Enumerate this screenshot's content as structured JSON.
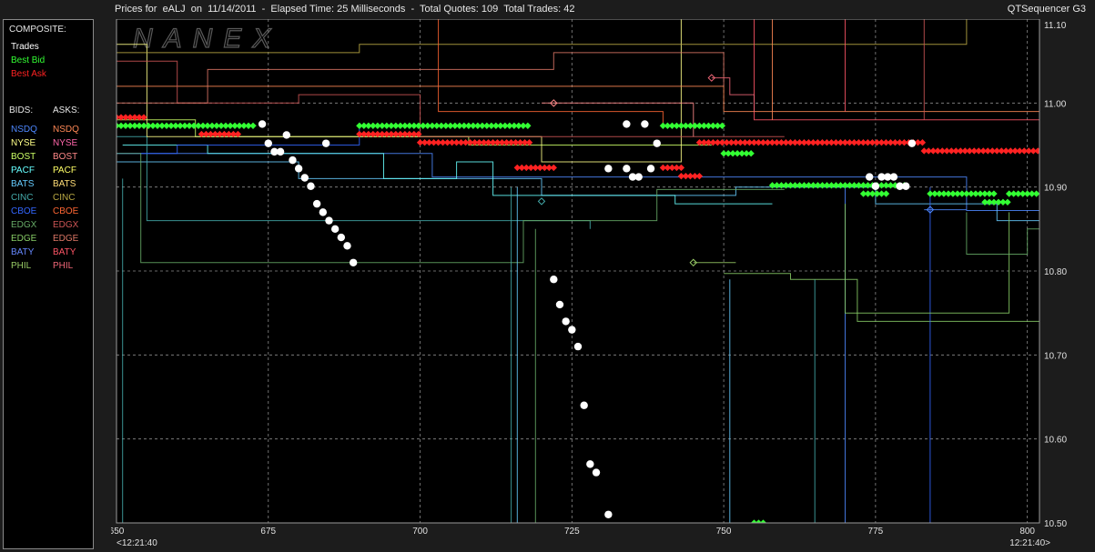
{
  "window": {
    "title": "Prices for  eALJ  on  11/14/2011  -  Elapsed Time: 25 Milliseconds  -  Total Quotes: 109  Total Trades: 42",
    "app_name": "QTSequencer G3",
    "watermark": "NANEX"
  },
  "legend": {
    "composite_header": "COMPOSITE:",
    "composite": [
      {
        "label": "Trades",
        "color": "#ffffff"
      },
      {
        "label": "Best Bid",
        "color": "#33ff33"
      },
      {
        "label": "Best Ask",
        "color": "#ff2222"
      }
    ],
    "bids_header": "BIDS:",
    "asks_header": "ASKS:",
    "exchanges": [
      {
        "bid": "NSDQ",
        "ask": "NSDQ",
        "bid_color": "#4d88ff",
        "ask_color": "#ff8855"
      },
      {
        "bid": "NYSE",
        "ask": "NYSE",
        "bid_color": "#ffff88",
        "ask_color": "#ff66aa"
      },
      {
        "bid": "BOST",
        "ask": "BOST",
        "bid_color": "#ccff66",
        "ask_color": "#ff8888"
      },
      {
        "bid": "PACF",
        "ask": "PACF",
        "bid_color": "#66ffff",
        "ask_color": "#ffff66"
      },
      {
        "bid": "BATS",
        "ask": "BATS",
        "bid_color": "#66ccff",
        "ask_color": "#ffdd77"
      },
      {
        "bid": "CINC",
        "ask": "CINC",
        "bid_color": "#44aaaa",
        "ask_color": "#bbaa44"
      },
      {
        "bid": "CBOE",
        "ask": "CBOE",
        "bid_color": "#3366ff",
        "ask_color": "#ff6633"
      },
      {
        "bid": "EDGX",
        "ask": "EDGX",
        "bid_color": "#66aa66",
        "ask_color": "#cc5555"
      },
      {
        "bid": "EDGE",
        "ask": "EDGE",
        "bid_color": "#88cc66",
        "ask_color": "#dd7766"
      },
      {
        "bid": "BATY",
        "ask": "BATY",
        "bid_color": "#6688ff",
        "ask_color": "#ff5566"
      },
      {
        "bid": "PHIL",
        "ask": "PHIL",
        "bid_color": "#99cc66",
        "ask_color": "#ee6677"
      }
    ]
  },
  "chart_data": {
    "type": "scatter",
    "title": "",
    "xlabel": "",
    "ylabel": "",
    "xlim": [
      650,
      802
    ],
    "ylim": [
      10.5,
      11.1
    ],
    "x_ticks": [
      650,
      675,
      700,
      725,
      750,
      775,
      800
    ],
    "x_tick_labels": [
      "650",
      "675",
      "700",
      "725",
      "750",
      "775",
      "800"
    ],
    "x_start_time": "<12:21:40",
    "x_end_time": "12:21:40>",
    "y_ticks": [
      10.5,
      10.6,
      10.7,
      10.8,
      10.9,
      11.0,
      11.1
    ],
    "y_tick_labels": [
      "10.50",
      "10.60",
      "10.70",
      "10.80",
      "10.90",
      "11.00",
      "11.10"
    ],
    "grid": true,
    "series": [
      {
        "name": "Trades",
        "color": "#ffffff",
        "points": [
          [
            674,
            10.975
          ],
          [
            675,
            10.952
          ],
          [
            676,
            10.942
          ],
          [
            677,
            10.942
          ],
          [
            678,
            10.962
          ],
          [
            679,
            10.932
          ],
          [
            680,
            10.922
          ],
          [
            681,
            10.911
          ],
          [
            682,
            10.901
          ],
          [
            683,
            10.88
          ],
          [
            684,
            10.87
          ],
          [
            684.5,
            10.952
          ],
          [
            685,
            10.86
          ],
          [
            686,
            10.85
          ],
          [
            687,
            10.84
          ],
          [
            688,
            10.83
          ],
          [
            689,
            10.81
          ],
          [
            722,
            10.79
          ],
          [
            723,
            10.76
          ],
          [
            724,
            10.74
          ],
          [
            725,
            10.73
          ],
          [
            726,
            10.71
          ],
          [
            727,
            10.64
          ],
          [
            728,
            10.57
          ],
          [
            729,
            10.56
          ],
          [
            731,
            10.51
          ],
          [
            731,
            10.922
          ],
          [
            734,
            10.975
          ],
          [
            734,
            10.922
          ],
          [
            735,
            10.912
          ],
          [
            736,
            10.912
          ],
          [
            737,
            10.975
          ],
          [
            738,
            10.922
          ],
          [
            739,
            10.952
          ],
          [
            774,
            10.912
          ],
          [
            775,
            10.901
          ],
          [
            776,
            10.912
          ],
          [
            777,
            10.912
          ],
          [
            778,
            10.912
          ],
          [
            779,
            10.901
          ],
          [
            780,
            10.901
          ],
          [
            781,
            10.952
          ]
        ]
      },
      {
        "name": "Best Bid",
        "color": "#33ff33",
        "segments": [
          [
            650,
            673,
            10.973
          ],
          [
            690,
            718,
            10.973
          ],
          [
            740,
            750,
            10.973
          ],
          [
            750,
            755,
            10.94
          ],
          [
            758,
            780,
            10.902
          ],
          [
            773,
            777,
            10.892
          ],
          [
            784,
            795,
            10.892
          ],
          [
            793,
            797,
            10.882
          ],
          [
            797,
            802,
            10.892
          ],
          [
            755,
            757,
            10.5
          ]
        ]
      },
      {
        "name": "Best Ask",
        "color": "#ff2222",
        "segments": [
          [
            650,
            655,
            10.983
          ],
          [
            664,
            670,
            10.963
          ],
          [
            690,
            700,
            10.963
          ],
          [
            700,
            718,
            10.953
          ],
          [
            716,
            722,
            10.923
          ],
          [
            740,
            743,
            10.923
          ],
          [
            743,
            746,
            10.913
          ],
          [
            746,
            783,
            10.953
          ],
          [
            783,
            802,
            10.943
          ]
        ]
      }
    ],
    "quote_lines": [
      {
        "color": "#4d88ff",
        "points": [
          [
            650,
            10.94
          ],
          [
            702,
            10.94
          ],
          [
            702,
            10.912
          ],
          [
            790,
            10.912
          ],
          [
            790,
            10.872
          ],
          [
            802,
            10.872
          ]
        ]
      },
      {
        "color": "#66ccff",
        "points": [
          [
            650,
            10.93
          ],
          [
            680,
            10.93
          ],
          [
            680,
            10.91
          ],
          [
            720,
            10.91
          ],
          [
            720,
            10.89
          ],
          [
            752,
            10.89
          ],
          [
            752,
            10.9
          ],
          [
            775,
            10.9
          ],
          [
            775,
            10.88
          ],
          [
            795,
            10.88
          ],
          [
            795,
            10.86
          ],
          [
            802,
            10.86
          ]
        ]
      },
      {
        "color": "#66ffff",
        "points": [
          [
            651,
            10.95
          ],
          [
            665,
            10.95
          ],
          [
            665,
            10.94
          ],
          [
            694,
            10.94
          ],
          [
            694,
            10.91
          ],
          [
            706,
            10.91
          ],
          [
            706,
            10.93
          ],
          [
            712,
            10.93
          ],
          [
            712,
            10.89
          ],
          [
            742,
            10.89
          ],
          [
            742,
            10.88
          ],
          [
            758,
            10.88
          ]
        ]
      },
      {
        "color": "#44aaaa",
        "points": [
          [
            650,
            10.96
          ],
          [
            655,
            10.96
          ],
          [
            655,
            10.86
          ],
          [
            728,
            10.86
          ],
          [
            728,
            10.85
          ]
        ]
      },
      {
        "color": "#3366ff",
        "points": [
          [
            650,
            10.94
          ],
          [
            660,
            10.94
          ],
          [
            660,
            10.95
          ],
          [
            690,
            10.95
          ],
          [
            690,
            10.97
          ]
        ]
      },
      {
        "color": "#66aa66",
        "points": [
          [
            650,
            10.94
          ],
          [
            654,
            10.94
          ],
          [
            654,
            10.81
          ],
          [
            717,
            10.81
          ],
          [
            717,
            10.86
          ],
          [
            739,
            10.86
          ],
          [
            739,
            10.897
          ],
          [
            760,
            10.897
          ]
        ]
      },
      {
        "color": "#88cc66",
        "points": [
          [
            750,
            10.797
          ],
          [
            761,
            10.797
          ],
          [
            761,
            10.79
          ],
          [
            772,
            10.79
          ],
          [
            772,
            10.74
          ],
          [
            802,
            10.74
          ]
        ]
      },
      {
        "color": "#99cc66",
        "points": [
          [
            745,
            10.81
          ],
          [
            752,
            10.81
          ]
        ]
      },
      {
        "color": "#ccff66",
        "points": [
          [
            650,
            10.98
          ],
          [
            663,
            10.98
          ],
          [
            663,
            10.96
          ],
          [
            708,
            10.96
          ],
          [
            708,
            10.95
          ],
          [
            748,
            10.95
          ]
        ]
      },
      {
        "color": "#ffff88",
        "points": [
          [
            650,
            11.07
          ],
          [
            655,
            11.07
          ],
          [
            655,
            10.96
          ],
          [
            720,
            10.96
          ],
          [
            720,
            10.93
          ],
          [
            743,
            10.93
          ],
          [
            743,
            11.1
          ]
        ]
      },
      {
        "color": "#bbaa44",
        "points": [
          [
            650,
            11.06
          ],
          [
            690,
            11.06
          ],
          [
            690,
            11.07
          ],
          [
            790,
            11.07
          ],
          [
            790,
            11.1
          ]
        ]
      },
      {
        "color": "#ff8855",
        "points": [
          [
            650,
            11.02
          ],
          [
            750,
            11.02
          ],
          [
            750,
            10.99
          ],
          [
            802,
            10.99
          ]
        ]
      },
      {
        "color": "#cc5555",
        "points": [
          [
            650,
            11.05
          ],
          [
            660,
            11.05
          ],
          [
            660,
            11.0
          ],
          [
            680,
            11.0
          ],
          [
            680,
            11.01
          ],
          [
            700,
            11.01
          ],
          [
            700,
            10.96
          ],
          [
            760,
            10.96
          ]
        ]
      },
      {
        "color": "#dd7766",
        "points": [
          [
            650,
            11.0
          ],
          [
            665,
            11.0
          ],
          [
            665,
            11.04
          ],
          [
            722,
            11.04
          ],
          [
            722,
            11.06
          ],
          [
            750,
            11.06
          ],
          [
            750,
            11.02
          ]
        ]
      },
      {
        "color": "#ff5566",
        "points": [
          [
            755,
            11.1
          ],
          [
            755,
            10.98
          ],
          [
            802,
            10.98
          ]
        ]
      },
      {
        "color": "#ff6633",
        "points": [
          [
            703,
            11.1
          ],
          [
            703,
            10.99
          ],
          [
            740,
            10.99
          ],
          [
            740,
            10.97
          ]
        ]
      },
      {
        "color": "#ee6677",
        "points": [
          [
            748,
            11.03
          ],
          [
            751,
            11.03
          ],
          [
            751,
            11.01
          ],
          [
            755,
            11.01
          ],
          [
            755,
            10.99
          ]
        ]
      },
      {
        "color": "#ff8888",
        "points": [
          [
            720,
            11.0
          ],
          [
            745,
            11.0
          ],
          [
            745,
            10.96
          ]
        ]
      },
      {
        "color": "#4d88ff",
        "points": [
          [
            783,
            10.873
          ],
          [
            790,
            10.873
          ]
        ]
      },
      {
        "color": "#66ccff",
        "points": [
          [
            716,
            10.9
          ],
          [
            716,
            10.5
          ]
        ]
      },
      {
        "color": "#44aaaa",
        "points": [
          [
            715,
            10.9
          ],
          [
            715,
            10.5
          ]
        ]
      },
      {
        "color": "#66aa66",
        "points": [
          [
            719,
            10.85
          ],
          [
            719,
            10.5
          ]
        ]
      },
      {
        "color": "#44aaaa",
        "points": [
          [
            651,
            10.91
          ],
          [
            651,
            10.5
          ]
        ]
      },
      {
        "color": "#66ccff",
        "points": [
          [
            751,
            10.79
          ],
          [
            751,
            10.5
          ]
        ]
      },
      {
        "color": "#44aaaa",
        "points": [
          [
            765,
            10.79
          ],
          [
            765,
            10.5
          ]
        ]
      },
      {
        "color": "#4d88ff",
        "points": [
          [
            770,
            10.9
          ],
          [
            770,
            10.5
          ]
        ]
      },
      {
        "color": "#3366ff",
        "points": [
          [
            784,
            10.9
          ],
          [
            784,
            10.5
          ]
        ]
      },
      {
        "color": "#88cc66",
        "points": [
          [
            770,
            10.88
          ],
          [
            770,
            10.75
          ],
          [
            797,
            10.75
          ],
          [
            797,
            10.87
          ]
        ]
      },
      {
        "color": "#66aa66",
        "points": [
          [
            790,
            10.87
          ],
          [
            790,
            10.82
          ],
          [
            800,
            10.82
          ],
          [
            800,
            10.85
          ],
          [
            802,
            10.85
          ]
        ]
      },
      {
        "color": "#ff5566",
        "points": [
          [
            770,
            11.1
          ],
          [
            770,
            10.99
          ]
        ]
      },
      {
        "color": "#cc5555",
        "points": [
          [
            783,
            11.1
          ],
          [
            783,
            10.98
          ]
        ]
      },
      {
        "color": "#ff8855",
        "points": [
          [
            758,
            11.1
          ],
          [
            758,
            10.98
          ]
        ]
      }
    ],
    "quote_markers": [
      {
        "x": 722,
        "y": 11.0,
        "color": "#ff8888"
      },
      {
        "x": 748,
        "y": 11.03,
        "color": "#ee6677"
      },
      {
        "x": 720,
        "y": 10.883,
        "color": "#44aaaa"
      },
      {
        "x": 745,
        "y": 10.81,
        "color": "#99cc66"
      },
      {
        "x": 784,
        "y": 10.873,
        "color": "#4d88ff"
      }
    ]
  }
}
